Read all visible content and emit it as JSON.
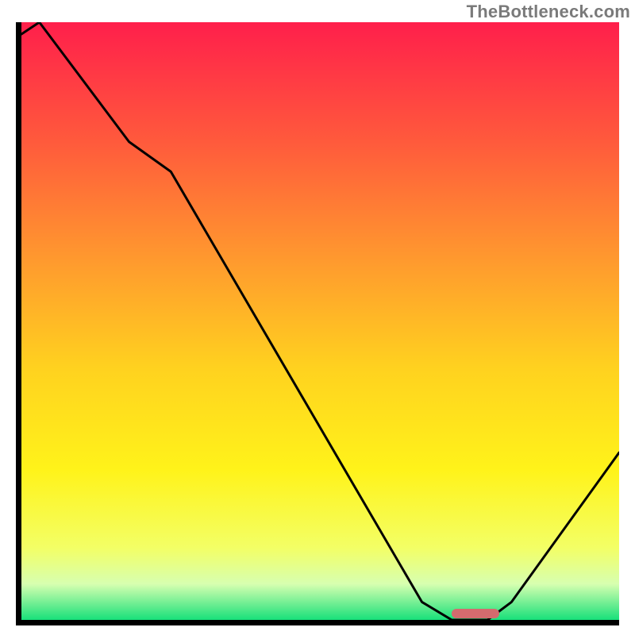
{
  "watermark": {
    "text": "TheBottleneck.com"
  },
  "colors": {
    "axis": "#000000",
    "curve": "#000000",
    "watermark_text": "#7a7a7a",
    "marker": "#d46b6e",
    "gradient_stops": [
      {
        "offset": 0.0,
        "color": "#ff1f4b"
      },
      {
        "offset": 0.2,
        "color": "#ff5a3c"
      },
      {
        "offset": 0.4,
        "color": "#ff9a2e"
      },
      {
        "offset": 0.58,
        "color": "#ffd21f"
      },
      {
        "offset": 0.75,
        "color": "#fff31a"
      },
      {
        "offset": 0.88,
        "color": "#f3ff66"
      },
      {
        "offset": 0.94,
        "color": "#d7ffb0"
      },
      {
        "offset": 1.0,
        "color": "#18e07a"
      }
    ]
  },
  "chart_data": {
    "type": "line",
    "title": "",
    "xlabel": "",
    "ylabel": "",
    "xlim": [
      0,
      100
    ],
    "ylim": [
      0,
      100
    ],
    "x": [
      0,
      3,
      18,
      25,
      67,
      72,
      78,
      82,
      100
    ],
    "values": [
      98,
      100,
      80,
      75,
      3,
      0,
      0,
      3,
      28
    ],
    "flat_minimum": {
      "x_start": 72,
      "x_end": 78,
      "y": 0
    },
    "marker": {
      "x_start": 72,
      "x_end": 80,
      "y": 0
    }
  }
}
